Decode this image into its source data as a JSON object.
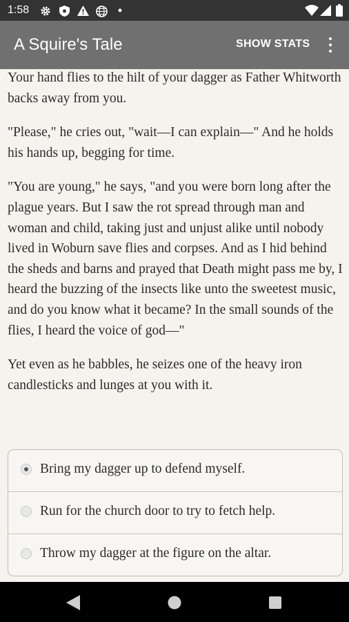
{
  "status_bar": {
    "time": "1:58",
    "icons": [
      "settings-icon",
      "shield-icon",
      "alert-icon",
      "globe-icon",
      "dot-icon",
      "wifi-icon",
      "signal-icon",
      "battery-icon"
    ]
  },
  "app_bar": {
    "title": "A Squire's Tale",
    "show_stats_label": "SHOW STATS",
    "overflow_icon": "more-vert-icon"
  },
  "story": {
    "paragraphs": [
      "Your hand flies to the hilt of your dagger as Father Whitworth backs away from you.",
      "\"Please,\" he cries out, \"wait—I can explain—\" And he holds his hands up, begging for time.",
      "\"You are young,\" he says, \"and you were born long after the plague years. But I saw the rot spread through man and woman and child, taking just and unjust alike until nobody lived in Woburn save flies and corpses. And as I hid behind the sheds and barns and prayed that Death might pass me by, I heard the buzzing of the insects like unto the sweetest music, and do you know what it became? In the small sounds of the flies, I heard the voice of god—\"",
      "Yet even as he babbles, he seizes one of the heavy iron candlesticks and lunges at you with it."
    ]
  },
  "choices": [
    {
      "label": "Bring my dagger up to defend myself.",
      "selected": true
    },
    {
      "label": "Run for the church door to try to fetch help.",
      "selected": false
    },
    {
      "label": "Throw my dagger at the figure on the altar.",
      "selected": false
    }
  ],
  "nav_bar": {
    "icons": [
      "back-icon",
      "home-icon",
      "recents-icon"
    ]
  },
  "colors": {
    "app_bar": "#707070",
    "status_bar": "#333333",
    "background": "#f6f3ee",
    "text": "#2b2b2b"
  }
}
